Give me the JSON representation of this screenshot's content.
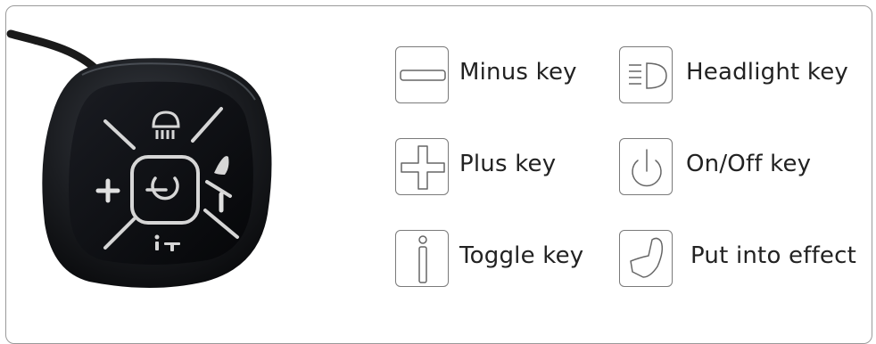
{
  "keys": [
    {
      "id": "minus",
      "label": "Minus key",
      "icon": "minus-icon"
    },
    {
      "id": "plus",
      "label": "Plus key",
      "icon": "plus-icon"
    },
    {
      "id": "toggle",
      "label": "Toggle key",
      "icon": "toggle-icon"
    },
    {
      "id": "headlight",
      "label": "Headlight key",
      "icon": "headlight-icon"
    },
    {
      "id": "onoff",
      "label": "On/Off key",
      "icon": "power-icon"
    },
    {
      "id": "effect",
      "label": "Put into effect",
      "icon": "walk-assist-icon"
    }
  ],
  "colors": {
    "icon_stroke": "#666666",
    "device_body": "#1c1f24",
    "device_face": "#0c0d10",
    "device_symbols": "#d6d6d6"
  }
}
